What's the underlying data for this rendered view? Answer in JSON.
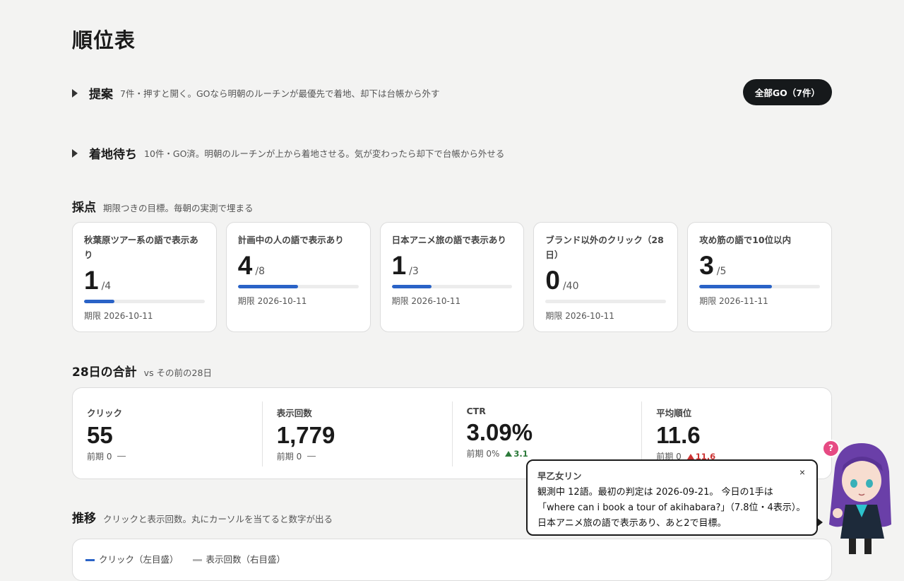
{
  "page": {
    "title": "順位表"
  },
  "proposals": {
    "title": "提案",
    "description": "7件・押すと開く。GOなら明朝のルーチンが最優先で着地、却下は台帳から外す",
    "go_all_label": "全部GO（7件）"
  },
  "landing": {
    "title": "着地待ち",
    "description": "10件・GO済。明朝のルーチンが上から着地させる。気が変わったら却下で台帳から外せる"
  },
  "scoring": {
    "title": "採点",
    "description": "期限つきの目標。毎朝の実測で埋まる",
    "goals": [
      {
        "label": "秋葉原ツアー系の語で表示あり",
        "value": "1",
        "target": "/4",
        "progress": 0.25,
        "deadline": "期限 2026-10-11"
      },
      {
        "label": "計画中の人の語で表示あり",
        "value": "4",
        "target": "/8",
        "progress": 0.5,
        "deadline": "期限 2026-10-11"
      },
      {
        "label": "日本アニメ旅の語で表示あり",
        "value": "1",
        "target": "/3",
        "progress": 0.333,
        "deadline": "期限 2026-10-11"
      },
      {
        "label": "ブランド以外のクリック（28日）",
        "value": "0",
        "target": "/40",
        "progress": 0.0,
        "deadline": "期限 2026-10-11"
      },
      {
        "label": "攻め筋の語で10位以内",
        "value": "3",
        "target": "/5",
        "progress": 0.6,
        "deadline": "期限 2026-11-11"
      }
    ]
  },
  "totals": {
    "title": "28日の合計",
    "subtitle": "vs その前の28日",
    "metrics": [
      {
        "label": "クリック",
        "value": "55",
        "prev": "前期 0",
        "delta": ""
      },
      {
        "label": "表示回数",
        "value": "1,779",
        "prev": "前期 0",
        "delta": ""
      },
      {
        "label": "CTR",
        "value": "3.09%",
        "prev": "前期 0%",
        "delta": "3.1"
      },
      {
        "label": "平均順位",
        "value": "11.6",
        "prev": "前期 0",
        "delta": "11.6"
      }
    ]
  },
  "trend": {
    "title": "推移",
    "description": "クリックと表示回数。丸にカーソルを当てると数字が出る",
    "legend": [
      {
        "label": "クリック（左目盛）",
        "color": "#2a63c7"
      },
      {
        "label": "表示回数（右目盛）",
        "color": "#b5b5b5"
      }
    ]
  },
  "assistant": {
    "name": "早乙女リン",
    "message": "観測中 12語。最初の判定は 2026-09-21。 今日の1手は「where can i book a tour of akihabara?」（7.8位・4表示）。 日本アニメ旅の語で表示あり、あと2で目標。",
    "close": "×",
    "help": "?"
  },
  "colors": {
    "accent": "#2a63c7",
    "up": "#2c7a3a",
    "down": "#cc3333",
    "dark_button": "#16191b",
    "help": "#e64a83"
  }
}
